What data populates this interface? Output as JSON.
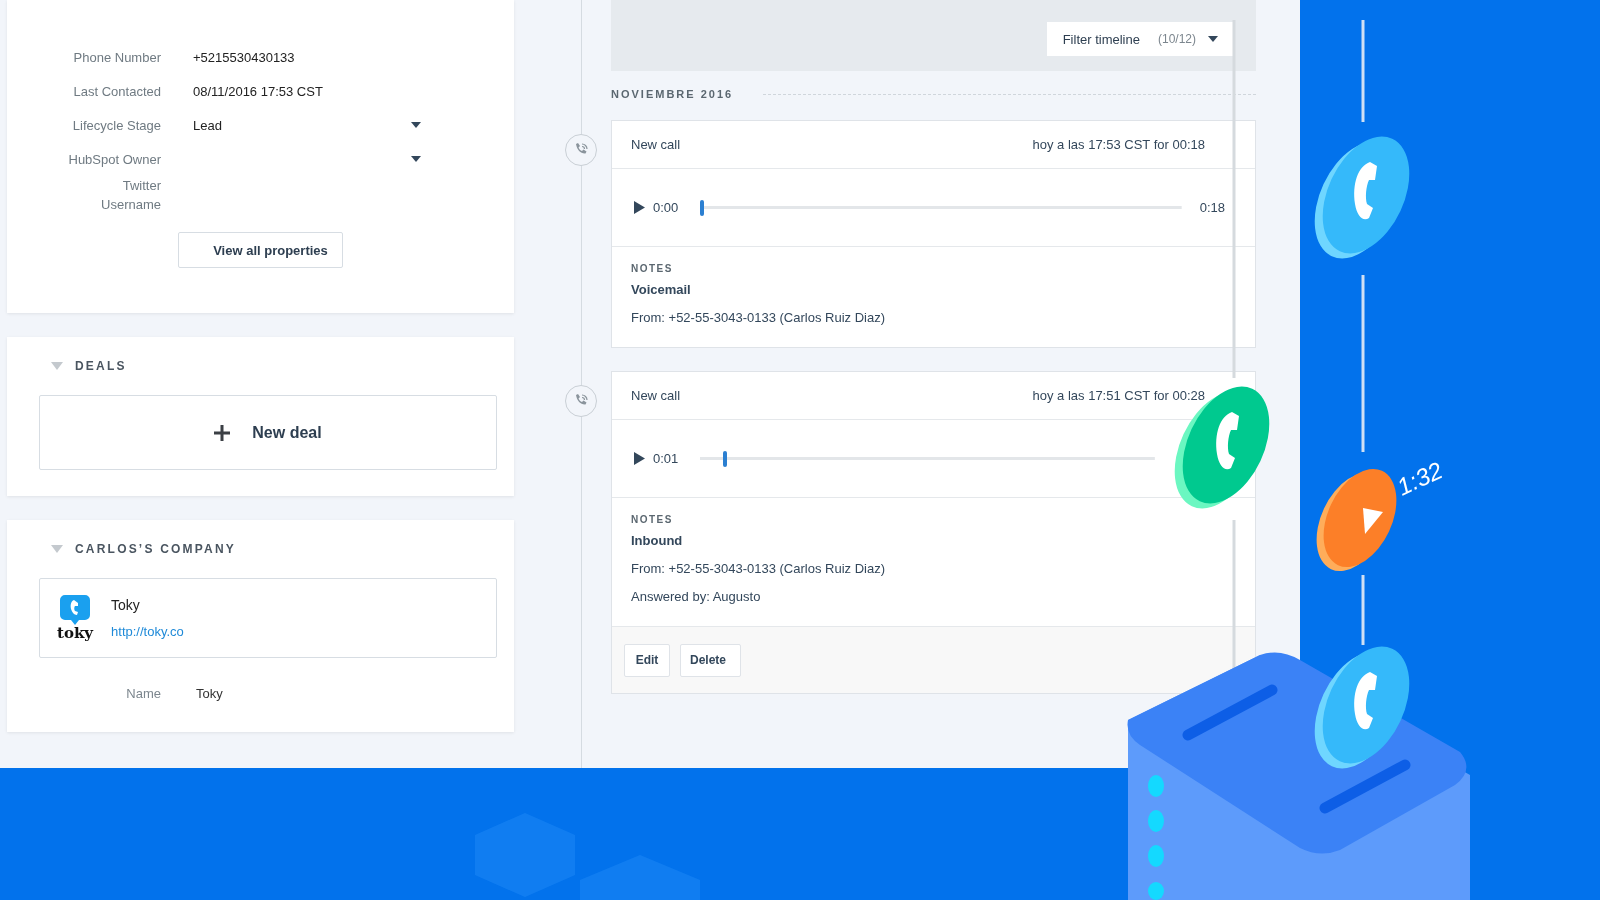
{
  "contact_properties": [
    {
      "label": "Phone Number",
      "value": "+5215530430133",
      "kind": "text"
    },
    {
      "label": "Last Contacted",
      "value": "08/11/2016 17:53 CST",
      "kind": "text"
    },
    {
      "label": "Lifecycle Stage",
      "value": "Lead",
      "kind": "select"
    },
    {
      "label": "HubSpot Owner",
      "kind": "select"
    },
    {
      "label": "Twitter Username",
      "kind": "text"
    }
  ],
  "view_all_button": "View all properties",
  "deals": {
    "title": "DEALS",
    "expanded": true,
    "new_deal_button": "New deal"
  },
  "company": {
    "title": "CARLOS’S COMPANY",
    "expanded": true,
    "logo_text": "toky",
    "name": "Toky",
    "url": "http://toky.co",
    "properties": [
      {
        "label": "Name",
        "value": "Toky"
      }
    ]
  },
  "timeline": {
    "filter": {
      "label": "Filter timeline",
      "count": "(10/12)"
    },
    "month": "NOVIEMBRE 2016",
    "events": [
      {
        "title": "New call",
        "time": "hoy a las 17:53 CST for 00:18",
        "player": {
          "current": "0:00",
          "level": 0,
          "duration": "0:18"
        },
        "notes_heading": "NOTES",
        "notes_title": "Voicemail",
        "notes_lines": [
          "From: +52-55-3043-0133 (Carlos Ruiz Diaz)"
        ]
      },
      {
        "title": "New call",
        "time": "hoy a las 17:51 CST for 00:28",
        "player": {
          "current": "0:01",
          "level": 0.05
        },
        "notes_heading": "NOTES",
        "notes_title": "Inbound",
        "notes_lines": [
          "From: +52-55-3043-0133 (Carlos Ruiz Diaz)",
          "Answered by: Augusto"
        ],
        "actions": [
          "Edit",
          "Delete"
        ]
      }
    ]
  },
  "illustration": {
    "duration_label": "1:32"
  }
}
